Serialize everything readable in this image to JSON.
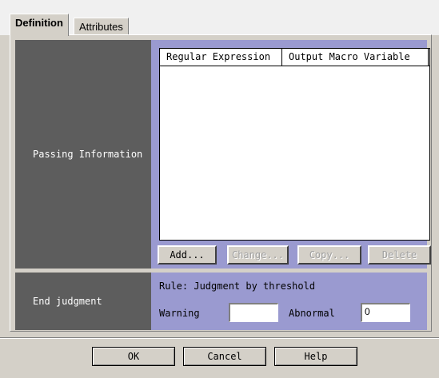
{
  "tabs": [
    {
      "label": "Definition",
      "active": true
    },
    {
      "label": "Attributes",
      "active": false
    }
  ],
  "passing": {
    "label": "Passing Information",
    "columns": [
      "Regular Expression",
      "Output Macro Variable"
    ],
    "rows": [],
    "buttons": {
      "add": "Add...",
      "change": "Change...",
      "copy": "Copy...",
      "delete": "Delete"
    }
  },
  "end_judgment": {
    "label": "End judgment",
    "rule": "Rule: Judgment by threshold",
    "warning_label": "Warning",
    "warning_value": "",
    "abnormal_label": "Abnormal",
    "abnormal_value": "0"
  },
  "footer": {
    "ok": "OK",
    "cancel": "Cancel",
    "help": "Help"
  },
  "colors": {
    "label_bg": "#5d5d5d",
    "content_bg": "#9a9ad0",
    "dialog_bg": "#d4d0c8"
  }
}
